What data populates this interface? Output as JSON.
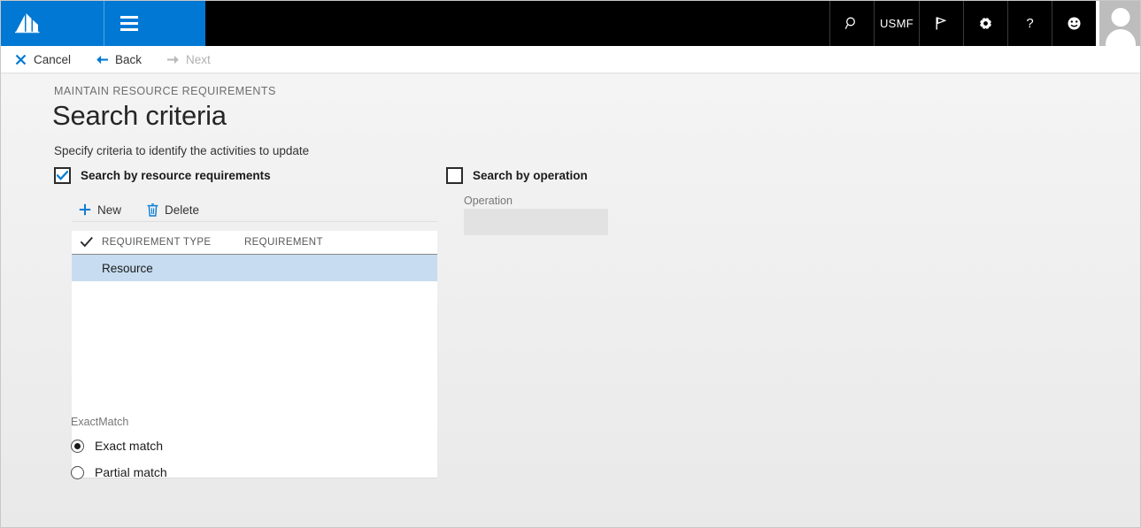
{
  "window": {
    "accent_color": "#0078d4",
    "topbar_color": "#000000",
    "selection_color": "#c7dcf0",
    "page_background": "#efefef"
  },
  "topbar": {
    "logo_name": "dynamics-365-logo",
    "hamburger_label": "Navigation menu",
    "nav_items": [
      {
        "name": "search-icon",
        "label": ""
      },
      {
        "name": "company-selector",
        "label": "USMF"
      },
      {
        "name": "flag-icon",
        "label": ""
      },
      {
        "name": "settings-gear-icon",
        "label": ""
      },
      {
        "name": "help-icon",
        "label": "?"
      },
      {
        "name": "feedback-smiley-icon",
        "label": ""
      }
    ],
    "avatar_name": "user-avatar"
  },
  "action_bar": {
    "buttons": [
      {
        "name": "cancel-button",
        "label": "Cancel",
        "icon": "close-icon",
        "disabled": false
      },
      {
        "name": "back-button",
        "label": "Back",
        "icon": "arrow-left-icon",
        "disabled": false
      },
      {
        "name": "next-button",
        "label": "Next",
        "icon": "arrow-right-icon",
        "disabled": true
      }
    ]
  },
  "page": {
    "caption": "MAINTAIN RESOURCE REQUIREMENTS",
    "title": "Search criteria",
    "subtitle": "Specify criteria to identify the activities to update"
  },
  "search_by_resource_requirements": {
    "label": "Search by resource requirements",
    "checked": true,
    "toolbar": [
      {
        "name": "new-button",
        "label": "New",
        "icon": "plus-icon"
      },
      {
        "name": "delete-button",
        "label": "Delete",
        "icon": "trash-icon"
      }
    ],
    "grid": {
      "columns": [
        "REQUIREMENT TYPE",
        "REQUIREMENT"
      ],
      "rows": [
        {
          "requirement_type": "Resource",
          "requirement": "",
          "selected": true
        }
      ]
    }
  },
  "search_by_operation": {
    "label": "Search by operation",
    "checked": false,
    "operation_field": {
      "label": "Operation",
      "value": "",
      "placeholder": "",
      "disabled": true
    }
  },
  "exact_match": {
    "label": "ExactMatch",
    "options": [
      {
        "name": "exact-match-radio",
        "label": "Exact match",
        "selected": true
      },
      {
        "name": "partial-match-radio",
        "label": "Partial match",
        "selected": false
      }
    ]
  }
}
